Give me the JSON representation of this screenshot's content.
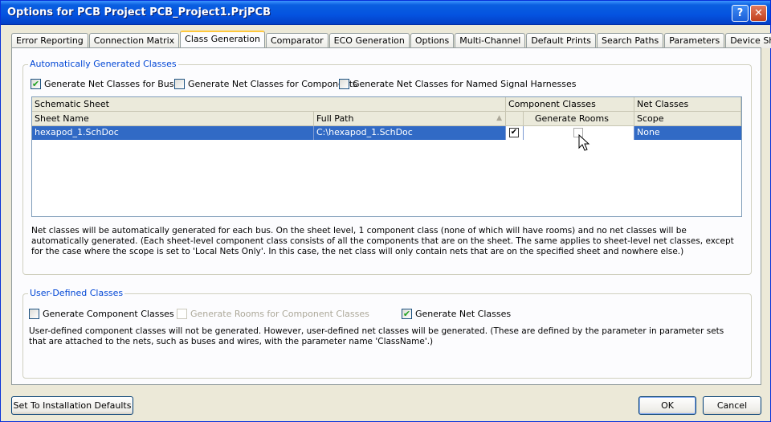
{
  "window": {
    "title": "Options for PCB Project PCB_Project1.PrjPCB"
  },
  "tabs": [
    {
      "label": "Error Reporting"
    },
    {
      "label": "Connection Matrix"
    },
    {
      "label": "Class Generation",
      "active": true
    },
    {
      "label": "Comparator"
    },
    {
      "label": "ECO Generation"
    },
    {
      "label": "Options"
    },
    {
      "label": "Multi-Channel"
    },
    {
      "label": "Default Prints"
    },
    {
      "label": "Search Paths"
    },
    {
      "label": "Parameters"
    },
    {
      "label": "Device Sheets"
    }
  ],
  "auto": {
    "title": "Automatically Generated Classes",
    "cb_buses": {
      "label": "Generate Net Classes for Buses",
      "checked": true
    },
    "cb_components": {
      "label": "Generate Net Classes for Components",
      "checked": false
    },
    "cb_harnesses": {
      "label": "Generate Net Classes for Named Signal Harnesses",
      "checked": false
    },
    "grid": {
      "group_headers": [
        "Schematic Sheet",
        "Component Classes",
        "Net Classes"
      ],
      "columns": [
        "Sheet Name",
        "Full Path",
        "Generate Rooms",
        "Scope"
      ],
      "rows": [
        {
          "sheet_name": "hexapod_1.SchDoc",
          "full_path": "C:\\hexapod_1.SchDoc",
          "component_class": true,
          "generate_rooms": false,
          "scope": "None"
        }
      ]
    },
    "description": "Net classes will be automatically generated for each bus. On the sheet level, 1 component class (none of which will have rooms) and no net classes will be automatically generated. (Each sheet-level component class consists of all the components that are on the sheet. The same applies to sheet-level net classes, except for the case where the scope is set to 'Local Nets Only'. In this case, the net class will only contain nets that are on the specified sheet and nowhere else.)"
  },
  "user": {
    "title": "User-Defined Classes",
    "cb_component": {
      "label": "Generate Component Classes",
      "checked": false
    },
    "cb_rooms": {
      "label": "Generate Rooms for Component Classes",
      "checked": false,
      "disabled": true
    },
    "cb_net": {
      "label": "Generate Net Classes",
      "checked": true
    },
    "description": "User-defined component classes will not be generated. However, user-defined net classes will be generated. (These are defined by the parameter in parameter sets that are attached to the nets, such as buses and wires, with the parameter name 'ClassName'.)"
  },
  "buttons": {
    "defaults": "Set To Installation Defaults",
    "ok": "OK",
    "cancel": "Cancel"
  }
}
